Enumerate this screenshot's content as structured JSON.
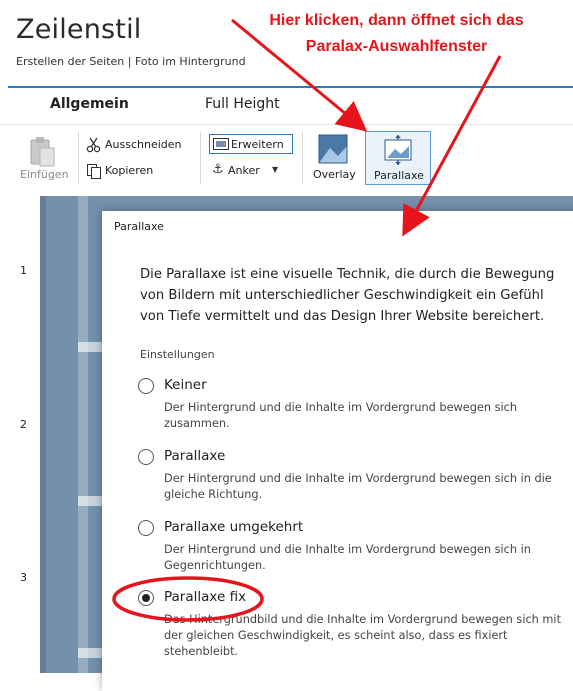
{
  "header": {
    "title": "Zeilenstil",
    "subtitle": "Erstellen der Seiten | Foto im Hintergrund"
  },
  "tabs": [
    {
      "label": "Allgemein",
      "active": true
    },
    {
      "label": "Full Height",
      "active": false
    }
  ],
  "ribbon": {
    "paste_label": "Einfügen",
    "cut_label": "Ausschneiden",
    "copy_label": "Kopieren",
    "expand_label": "Erweitern",
    "anchor_label": "Anker",
    "overlay_label": "Overlay",
    "parallax_label": "Parallaxe"
  },
  "ruler": {
    "numbers": [
      "1",
      "2",
      "3"
    ]
  },
  "dialog": {
    "title": "Parallaxe",
    "description": "Die Parallaxe ist eine visuelle Technik, die durch die Bewegung von Bildern mit unterschiedlicher Geschwindigkeit ein Gefühl von Tiefe vermittelt und das Design Ihrer Website bereichert.",
    "settings_label": "Einstellungen",
    "options": [
      {
        "label": "Keiner",
        "description": "Der Hintergrund und die Inhalte im Vordergrund bewegen sich zusammen.",
        "selected": false
      },
      {
        "label": "Parallaxe",
        "description": "Der Hintergrund und die Inhalte im Vordergrund bewegen sich in die gleiche Richtung.",
        "selected": false
      },
      {
        "label": "Parallaxe umgekehrt",
        "description": "Der Hintergrund und die Inhalte im Vordergrund bewegen sich in Gegenrichtungen.",
        "selected": false
      },
      {
        "label": "Parallaxe fix",
        "description": "Das Hintergrundbild und die Inhalte im Vordergrund bewegen sich mit der gleichen Geschwindigkeit, es scheint also, dass es fixiert stehenbleibt.",
        "selected": true
      }
    ]
  },
  "annotation": {
    "line1": "Hier klicken, dann öffnet sich das",
    "line2": "Paralax-Auswahlfenster",
    "color": "#e8141b"
  },
  "colors": {
    "accent": "#2b7bbf",
    "page_background": "#7490ab"
  }
}
